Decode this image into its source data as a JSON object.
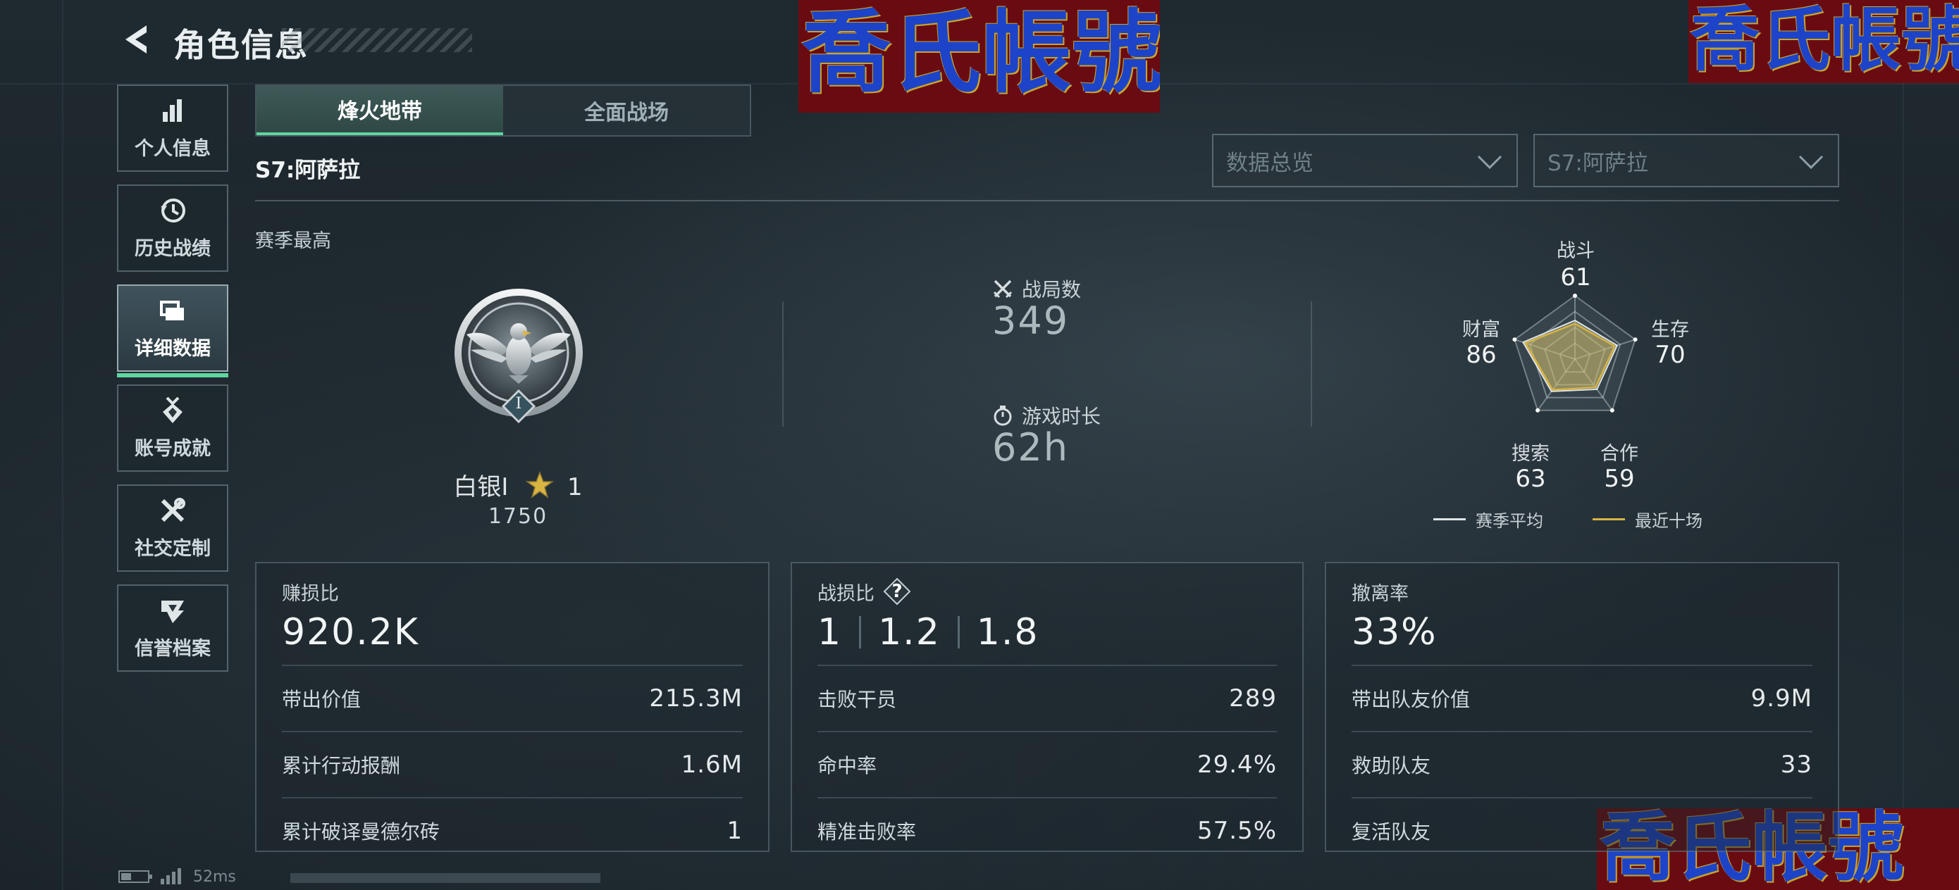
{
  "header": {
    "title": "角色信息"
  },
  "watermark": {
    "text": "喬氏帳號"
  },
  "sidebar": {
    "items": [
      {
        "label": "个人信息",
        "icon": "bar-chart-icon"
      },
      {
        "label": "历史战绩",
        "icon": "history-icon"
      },
      {
        "label": "详细数据",
        "icon": "folder-icon",
        "active": true
      },
      {
        "label": "账号成就",
        "icon": "medal-icon"
      },
      {
        "label": "社交定制",
        "icon": "tools-icon"
      },
      {
        "label": "信誉档案",
        "icon": "shield-badge-icon"
      }
    ]
  },
  "tabs": [
    {
      "label": "烽火地带",
      "active": true
    },
    {
      "label": "全面战场",
      "active": false
    }
  ],
  "season": {
    "heading": "S7:阿萨拉",
    "best_label": "赛季最高"
  },
  "filters": {
    "view_placeholder": "数据总览",
    "season_placeholder": "S7:阿萨拉"
  },
  "rank": {
    "name": "白银I",
    "stars": "1",
    "score": "1750",
    "badge_numeral": "I"
  },
  "stats": {
    "matches_label": "战局数",
    "matches_value": "349",
    "playtime_label": "游戏时长",
    "playtime_value": "62h"
  },
  "radar": {
    "axes": [
      {
        "label": "战斗",
        "value": "61"
      },
      {
        "label": "生存",
        "value": "70"
      },
      {
        "label": "合作",
        "value": "59"
      },
      {
        "label": "搜索",
        "value": "63"
      },
      {
        "label": "财富",
        "value": "86"
      }
    ],
    "season_avg": [
      0.61,
      0.7,
      0.59,
      0.63,
      0.86
    ],
    "recent_ten": [
      0.56,
      0.66,
      0.55,
      0.6,
      0.82
    ],
    "legend_season": "赛季平均",
    "legend_recent": "最近十场",
    "colors": {
      "season": "#dfe5e7",
      "recent": "#d8b443"
    }
  },
  "cards": {
    "profit": {
      "title": "赚损比",
      "value": "920.2K",
      "rows": [
        {
          "label": "带出价值",
          "value": "215.3M"
        },
        {
          "label": "累计行动报酬",
          "value": "1.6M"
        },
        {
          "label": "累计破译曼德尔砖",
          "value": "1"
        }
      ]
    },
    "kd": {
      "title": "战损比",
      "help": "?",
      "values": [
        "1",
        "1.2",
        "1.8"
      ],
      "rows": [
        {
          "label": "击败干员",
          "value": "289"
        },
        {
          "label": "命中率",
          "value": "29.4%"
        },
        {
          "label": "精准击败率",
          "value": "57.5%"
        }
      ]
    },
    "extract": {
      "title": "撤离率",
      "value": "33%",
      "rows": [
        {
          "label": "带出队友价值",
          "value": "9.9M"
        },
        {
          "label": "救助队友",
          "value": "33"
        },
        {
          "label": "复活队友",
          "value": ""
        }
      ]
    }
  },
  "status": {
    "latency": "52ms"
  },
  "colors": {
    "accent": "#5fd6a0",
    "gold": "#d8b443",
    "bg": "#1c262b"
  }
}
